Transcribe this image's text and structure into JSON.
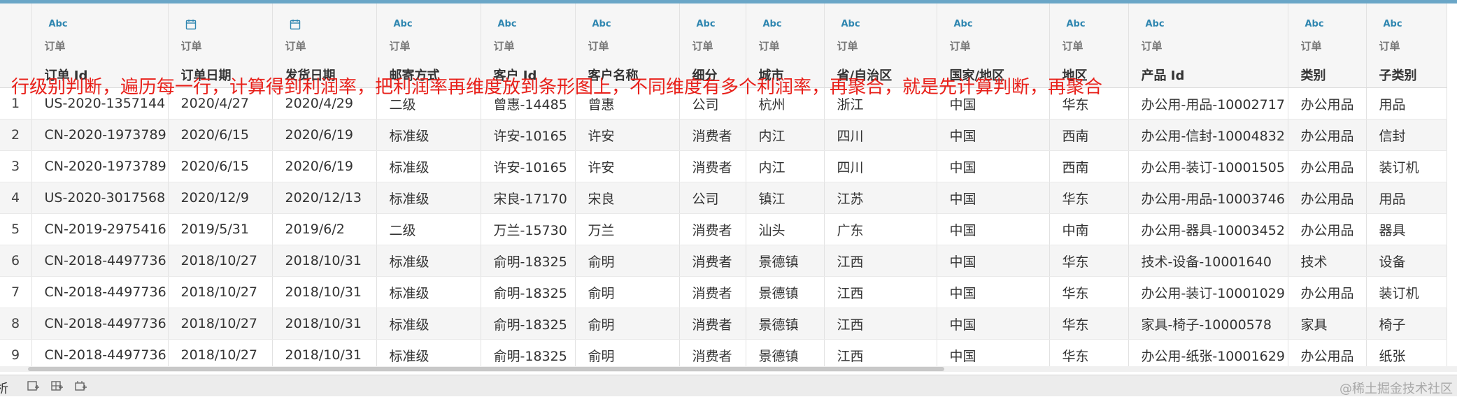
{
  "columns": [
    {
      "type_icon": "abc-type-icon",
      "type_label": "Abc",
      "source": "订单",
      "name": "订单 Id"
    },
    {
      "type_icon": "calendar-type-icon",
      "type_label": "",
      "source": "订单",
      "name": "订单日期"
    },
    {
      "type_icon": "calendar-type-icon",
      "type_label": "",
      "source": "订单",
      "name": "发货日期"
    },
    {
      "type_icon": "abc-type-icon",
      "type_label": "Abc",
      "source": "订单",
      "name": "邮寄方式"
    },
    {
      "type_icon": "abc-type-icon",
      "type_label": "Abc",
      "source": "订单",
      "name": "客户 Id"
    },
    {
      "type_icon": "abc-type-icon",
      "type_label": "Abc",
      "source": "订单",
      "name": "客户名称"
    },
    {
      "type_icon": "abc-type-icon",
      "type_label": "Abc",
      "source": "订单",
      "name": "细分"
    },
    {
      "type_icon": "abc-type-icon",
      "type_label": "Abc",
      "source": "订单",
      "name": "城市"
    },
    {
      "type_icon": "abc-type-icon",
      "type_label": "Abc",
      "source": "订单",
      "name": "省/自治区"
    },
    {
      "type_icon": "abc-type-icon",
      "type_label": "Abc",
      "source": "订单",
      "name": "国家/地区"
    },
    {
      "type_icon": "abc-type-icon",
      "type_label": "Abc",
      "source": "订单",
      "name": "地区"
    },
    {
      "type_icon": "abc-type-icon",
      "type_label": "Abc",
      "source": "订单",
      "name": "产品 Id"
    },
    {
      "type_icon": "abc-type-icon",
      "type_label": "Abc",
      "source": "订单",
      "name": "类别"
    },
    {
      "type_icon": "abc-type-icon",
      "type_label": "Abc",
      "source": "订单",
      "name": "子类别"
    }
  ],
  "rows": [
    {
      "num": "1",
      "cells": [
        "US-2020-1357144",
        "2020/4/27",
        "2020/4/29",
        "二级",
        "曾惠-14485",
        "曾惠",
        "公司",
        "杭州",
        "浙江",
        "中国",
        "华东",
        "办公用-用品-10002717",
        "办公用品",
        "用品"
      ]
    },
    {
      "num": "2",
      "cells": [
        "CN-2020-1973789",
        "2020/6/15",
        "2020/6/19",
        "标准级",
        "许安-10165",
        "许安",
        "消费者",
        "内江",
        "四川",
        "中国",
        "西南",
        "办公用-信封-10004832",
        "办公用品",
        "信封"
      ]
    },
    {
      "num": "3",
      "cells": [
        "CN-2020-1973789",
        "2020/6/15",
        "2020/6/19",
        "标准级",
        "许安-10165",
        "许安",
        "消费者",
        "内江",
        "四川",
        "中国",
        "西南",
        "办公用-装订-10001505",
        "办公用品",
        "装订机"
      ]
    },
    {
      "num": "4",
      "cells": [
        "US-2020-3017568",
        "2020/12/9",
        "2020/12/13",
        "标准级",
        "宋良-17170",
        "宋良",
        "公司",
        "镇江",
        "江苏",
        "中国",
        "华东",
        "办公用-用品-10003746",
        "办公用品",
        "用品"
      ]
    },
    {
      "num": "5",
      "cells": [
        "CN-2019-2975416",
        "2019/5/31",
        "2019/6/2",
        "二级",
        "万兰-15730",
        "万兰",
        "消费者",
        "汕头",
        "广东",
        "中国",
        "中南",
        "办公用-器具-10003452",
        "办公用品",
        "器具"
      ]
    },
    {
      "num": "6",
      "cells": [
        "CN-2018-4497736",
        "2018/10/27",
        "2018/10/31",
        "标准级",
        "俞明-18325",
        "俞明",
        "消费者",
        "景德镇",
        "江西",
        "中国",
        "华东",
        "技术-设备-10001640",
        "技术",
        "设备"
      ]
    },
    {
      "num": "7",
      "cells": [
        "CN-2018-4497736",
        "2018/10/27",
        "2018/10/31",
        "标准级",
        "俞明-18325",
        "俞明",
        "消费者",
        "景德镇",
        "江西",
        "中国",
        "华东",
        "办公用-装订-10001029",
        "办公用品",
        "装订机"
      ]
    },
    {
      "num": "8",
      "cells": [
        "CN-2018-4497736",
        "2018/10/27",
        "2018/10/31",
        "标准级",
        "俞明-18325",
        "俞明",
        "消费者",
        "景德镇",
        "江西",
        "中国",
        "华东",
        "家具-椅子-10000578",
        "家具",
        "椅子"
      ]
    },
    {
      "num": "9",
      "cells": [
        "CN-2018-4497736",
        "2018/10/27",
        "2018/10/31",
        "标准级",
        "俞明-18325",
        "俞明",
        "消费者",
        "景德镇",
        "江西",
        "中国",
        "华东",
        "办公用-纸张-10001629",
        "办公用品",
        "纸张"
      ]
    }
  ],
  "annotation": "行级别判断，遍历每一行，计算得到利润率，把利润率再维度放到条形图上，不同维度有多个利润率，再聚合，就是先计算判断，再聚合",
  "annotation_color": "#e8201a",
  "accent_color": "#6aa6c7",
  "type_icon_color": "#2f86b0",
  "statusbar": {
    "tab_partial": "析",
    "icons": [
      "new-worksheet-icon",
      "new-dashboard-icon",
      "new-story-icon"
    ],
    "watermark": "@稀土掘金技术社区"
  }
}
